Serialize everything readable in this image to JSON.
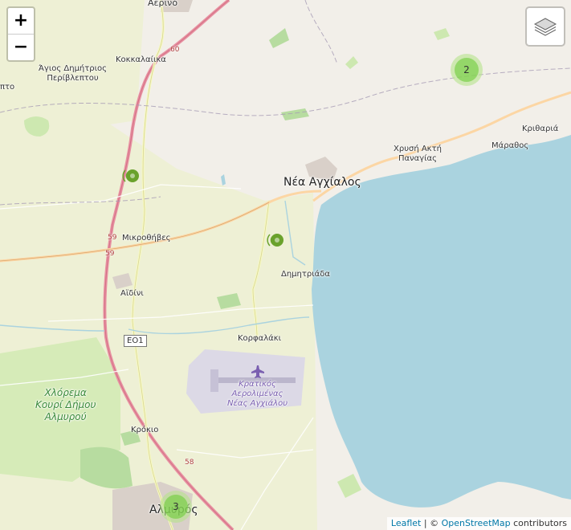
{
  "map": {
    "places": {
      "aerino": "Αερινό",
      "kokkalaiika": "Κοκκαλαίικα",
      "agios": "Άγιος Δημήτριος\nΠερίβλεπτου",
      "pto": "πτο",
      "nea_anchialos": "Νέα Αγχίαλος",
      "chrysi_akti": "Χρυσή Ακτή\nΠαναγίας",
      "marathos": "Μάραθος",
      "krithari": "Κριθαριά",
      "mikrothives": "Μικροθήβες",
      "dimitriada": "Δημητριάδα",
      "aidini": "Αϊδίνι",
      "korfalaki": "Κορφαλάκι",
      "krokio": "Κρόκιο",
      "almyros": "Αλμυρός"
    },
    "park_label": "Χλόρεμα\nΚουρί Δήμου\nΑλμυρού",
    "airport_label": "Κρατικός\nΑερολιμένας\nΝέας Αγχιάλου",
    "road_shields": {
      "r60": "60",
      "r59a": "59",
      "r59b": "59",
      "r58": "58",
      "eo1": "ΕΟ1"
    }
  },
  "controls": {
    "zoom_in": "+",
    "zoom_out": "−",
    "layers_icon": "layers-icon"
  },
  "clusters": [
    {
      "count": "2"
    },
    {
      "count": "3"
    }
  ],
  "markers": [
    {
      "icon": "wifi-signal-marker-icon"
    },
    {
      "icon": "wifi-signal-marker-icon"
    }
  ],
  "attribution": {
    "leaflet": "Leaflet",
    "sep": " | © ",
    "osm": "OpenStreetMap",
    "suffix": " contributors"
  },
  "colors": {
    "sea": "#aad3df",
    "land": "#f2efe9",
    "fields": "#eef0d5",
    "primary_road": "#e892a2",
    "secondary_road": "#f7fabf",
    "tertiary_road": "#fcd6a4",
    "cluster_outer": "rgba(181,226,140,0.6)",
    "cluster_inner": "rgba(110,204,57,0.6)"
  }
}
